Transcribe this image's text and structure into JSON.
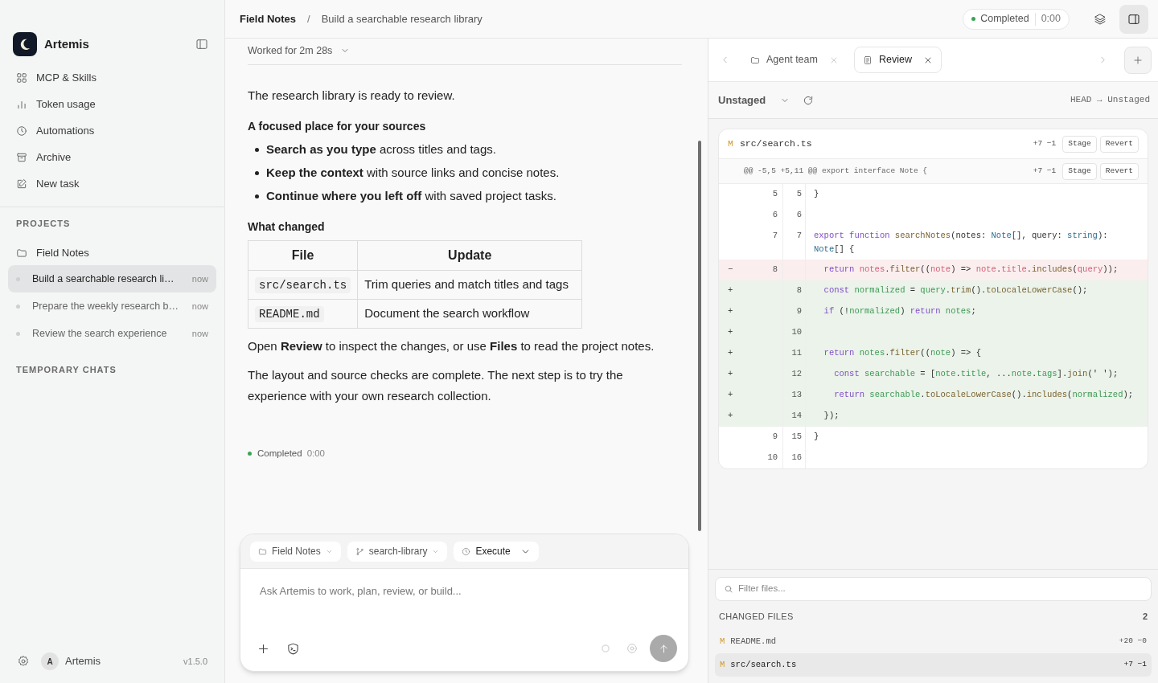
{
  "sidebar": {
    "app_name": "Artemis",
    "nav": [
      {
        "label": "MCP & Skills",
        "kind": "grid"
      },
      {
        "label": "Token usage",
        "kind": "bars"
      },
      {
        "label": "Automations",
        "kind": "clock"
      },
      {
        "label": "Archive",
        "kind": "archive"
      },
      {
        "label": "New task",
        "kind": "edit"
      }
    ],
    "projects_heading": "PROJECTS",
    "projects": [
      {
        "name": "Field Notes",
        "tasks": [
          {
            "title": "Build a searchable research li…",
            "time": "now",
            "selected": true
          },
          {
            "title": "Prepare the weekly research b…",
            "time": "now",
            "selected": false
          },
          {
            "title": "Review the search experience",
            "time": "now",
            "selected": false
          }
        ]
      }
    ],
    "temporary_heading": "TEMPORARY CHATS",
    "user": {
      "initial": "A",
      "name": "Artemis"
    },
    "version": "v1.5.0"
  },
  "header": {
    "breadcrumb": [
      "Field Notes",
      "Build a searchable research library"
    ],
    "separator": "/",
    "status": {
      "label": "Completed",
      "time": "0:00"
    }
  },
  "chat": {
    "worked": "Worked for 2m 28s",
    "blocks": [
      {
        "kind": "paragraph",
        "text": "The research library is ready to review."
      },
      {
        "kind": "heading",
        "text": "A focused place for your sources"
      },
      {
        "kind": "list",
        "items": [
          "**Search as you type** across titles and tags.",
          "**Keep the context** with source links and concise notes.",
          "**Continue where you left off** with saved project tasks."
        ]
      },
      {
        "kind": "heading",
        "text": "What changed"
      },
      {
        "kind": "table",
        "columns": [
          "File",
          "Update"
        ],
        "rows": [
          [
            "src/search.ts",
            "Trim queries and match titles and tags"
          ],
          [
            "README.md",
            "Document the search workflow"
          ]
        ]
      },
      {
        "kind": "paragraph",
        "text": "Open **Review** to inspect the changes, or use **Files** to read the project notes."
      },
      {
        "kind": "paragraph",
        "text": "The layout and source checks are complete. The next step is to try the experience with your own research collection."
      }
    ],
    "status": {
      "label": "Completed",
      "time": "0:00"
    }
  },
  "composer": {
    "chips": [
      {
        "label": "Field Notes",
        "kind": "folder"
      },
      {
        "label": "search-library",
        "kind": "branch"
      },
      {
        "label": "Execute",
        "kind": "mode"
      }
    ],
    "placeholder": "Ask Artemis to work, plan, review, or build..."
  },
  "right_panel": {
    "tabs": [
      {
        "label": "Agent team",
        "kind": "folder",
        "selected": false
      },
      {
        "label": "Review",
        "kind": "doc",
        "selected": true
      }
    ],
    "scope": "Unstaged",
    "comparison": "HEAD → Unstaged",
    "diff": {
      "status": "M",
      "path": "src/search.ts",
      "stats": "+7 −1",
      "actions": [
        "Stage",
        "Revert"
      ],
      "hunk": {
        "header": "@@ -5,5 +5,11 @@ export interface Note {",
        "stats": "+7 −1",
        "actions": [
          "Stage",
          "Revert"
        ]
      },
      "lines": [
        {
          "kind": "context",
          "old": "5",
          "new": "5",
          "tokens": [
            {
              "kind": "p",
              "text": "}"
            }
          ]
        },
        {
          "kind": "context",
          "old": "6",
          "new": "6"
        },
        {
          "kind": "context",
          "old": "7",
          "new": "7",
          "tokens": [
            {
              "kind": "kw",
              "text": "export function "
            },
            {
              "kind": "fn",
              "text": "searchNotes"
            },
            {
              "kind": "p",
              "text": "(notes: "
            },
            {
              "kind": "ty",
              "text": "Note"
            },
            {
              "kind": "p",
              "text": "[], query: "
            },
            {
              "kind": "ty",
              "text": "string"
            },
            {
              "kind": "p",
              "text": "): "
            },
            {
              "kind": "ty",
              "text": "Note"
            },
            {
              "kind": "p",
              "text": "[] {"
            }
          ]
        },
        {
          "kind": "removed",
          "sign": "−",
          "old": "8",
          "tokens": [
            {
              "kind": "kw",
              "text": "  return "
            },
            {
              "kind": "id",
              "text": "notes"
            },
            {
              "kind": "p",
              "text": "."
            },
            {
              "kind": "fn",
              "text": "filter"
            },
            {
              "kind": "p",
              "text": "(("
            },
            {
              "kind": "id",
              "text": "note"
            },
            {
              "kind": "p",
              "text": ") => "
            },
            {
              "kind": "id",
              "text": "note"
            },
            {
              "kind": "p",
              "text": "."
            },
            {
              "kind": "id",
              "text": "title"
            },
            {
              "kind": "p",
              "text": "."
            },
            {
              "kind": "fn",
              "text": "includes"
            },
            {
              "kind": "p",
              "text": "("
            },
            {
              "kind": "id",
              "text": "query"
            },
            {
              "kind": "p",
              "text": "));"
            }
          ]
        },
        {
          "kind": "added",
          "sign": "+",
          "new": "8",
          "tokens": [
            {
              "kind": "kw",
              "text": "  const "
            },
            {
              "kind": "id",
              "text": "normalized"
            },
            {
              "kind": "p",
              "text": " = "
            },
            {
              "kind": "id",
              "text": "query"
            },
            {
              "kind": "p",
              "text": "."
            },
            {
              "kind": "fn",
              "text": "trim"
            },
            {
              "kind": "p",
              "text": "()."
            },
            {
              "kind": "fn",
              "text": "toLocaleLowerCase"
            },
            {
              "kind": "p",
              "text": "();"
            }
          ]
        },
        {
          "kind": "added",
          "sign": "+",
          "new": "9",
          "tokens": [
            {
              "kind": "kw",
              "text": "  if"
            },
            {
              "kind": "p",
              "text": " (!"
            },
            {
              "kind": "id",
              "text": "normalized"
            },
            {
              "kind": "p",
              "text": ") "
            },
            {
              "kind": "kw",
              "text": "return "
            },
            {
              "kind": "id",
              "text": "notes"
            },
            {
              "kind": "p",
              "text": ";"
            }
          ]
        },
        {
          "kind": "added",
          "sign": "+",
          "new": "10"
        },
        {
          "kind": "added",
          "sign": "+",
          "new": "11",
          "tokens": [
            {
              "kind": "kw",
              "text": "  return "
            },
            {
              "kind": "id",
              "text": "notes"
            },
            {
              "kind": "p",
              "text": "."
            },
            {
              "kind": "fn",
              "text": "filter"
            },
            {
              "kind": "p",
              "text": "(("
            },
            {
              "kind": "id",
              "text": "note"
            },
            {
              "kind": "p",
              "text": ") => {"
            }
          ]
        },
        {
          "kind": "added",
          "sign": "+",
          "new": "12",
          "tokens": [
            {
              "kind": "kw",
              "text": "    const "
            },
            {
              "kind": "id",
              "text": "searchable"
            },
            {
              "kind": "p",
              "text": " = ["
            },
            {
              "kind": "id",
              "text": "note"
            },
            {
              "kind": "p",
              "text": "."
            },
            {
              "kind": "id",
              "text": "title"
            },
            {
              "kind": "p",
              "text": ", ..."
            },
            {
              "kind": "id",
              "text": "note"
            },
            {
              "kind": "p",
              "text": "."
            },
            {
              "kind": "id",
              "text": "tags"
            },
            {
              "kind": "p",
              "text": "]."
            },
            {
              "kind": "fn",
              "text": "join"
            },
            {
              "kind": "p",
              "text": "(' ');"
            }
          ]
        },
        {
          "kind": "added",
          "sign": "+",
          "new": "13",
          "tokens": [
            {
              "kind": "kw",
              "text": "    return "
            },
            {
              "kind": "id",
              "text": "searchable"
            },
            {
              "kind": "p",
              "text": "."
            },
            {
              "kind": "fn",
              "text": "toLocaleLowerCase"
            },
            {
              "kind": "p",
              "text": "()."
            },
            {
              "kind": "fn",
              "text": "includes"
            },
            {
              "kind": "p",
              "text": "("
            },
            {
              "kind": "id",
              "text": "normalized"
            },
            {
              "kind": "p",
              "text": ");"
            }
          ]
        },
        {
          "kind": "added",
          "sign": "+",
          "new": "14",
          "tokens": [
            {
              "kind": "p",
              "text": "  });"
            }
          ]
        },
        {
          "kind": "context",
          "old": "9",
          "new": "15",
          "tokens": [
            {
              "kind": "p",
              "text": "}"
            }
          ]
        },
        {
          "kind": "context",
          "old": "10",
          "new": "16"
        }
      ]
    },
    "filter_placeholder": "Filter files...",
    "changed_heading": "CHANGED FILES",
    "changed_count": "2",
    "changed_files": [
      {
        "status": "M",
        "path": "README.md",
        "stats": "+20 −0",
        "selected": false
      },
      {
        "status": "M",
        "path": "src/search.ts",
        "stats": "+7 −1",
        "selected": true
      }
    ]
  }
}
